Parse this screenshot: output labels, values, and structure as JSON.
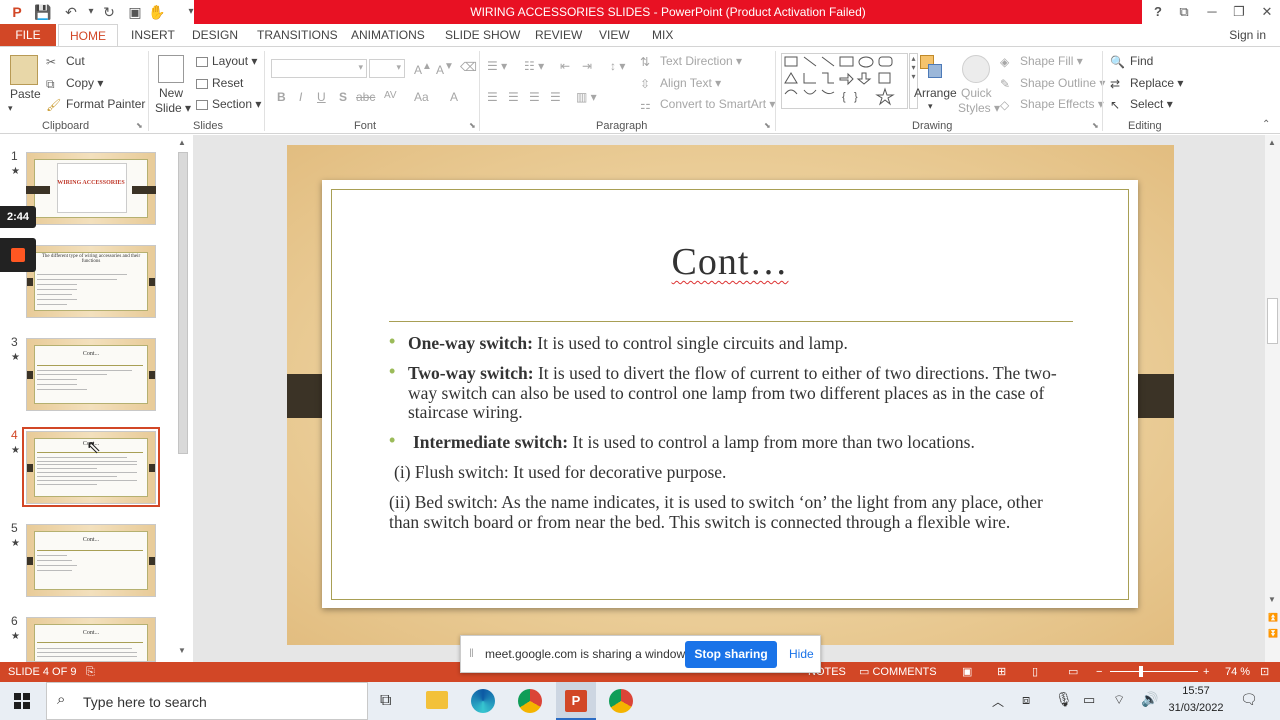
{
  "window": {
    "title": "WIRING ACCESSORIES SLIDES -  PowerPoint (Product Activation Failed)",
    "help": "?",
    "sign_in": "Sign in"
  },
  "tabs": [
    "FILE",
    "HOME",
    "INSERT",
    "DESIGN",
    "TRANSITIONS",
    "ANIMATIONS",
    "SLIDE SHOW",
    "REVIEW",
    "VIEW",
    "MIX"
  ],
  "ribbon": {
    "clipboard": {
      "label": "Clipboard",
      "paste": "Paste",
      "cut": "Cut",
      "copy": "Copy",
      "format_painter": "Format Painter"
    },
    "slides": {
      "label": "Slides",
      "new_slide_1": "New",
      "new_slide_2": "Slide",
      "layout": "Layout",
      "reset": "Reset",
      "section": "Section"
    },
    "font": {
      "label": "Font",
      "bold": "B",
      "italic": "I",
      "underline": "U",
      "shadow": "S",
      "strike": "abc",
      "spacing": "AV",
      "case": "Aa",
      "color": "A"
    },
    "paragraph": {
      "label": "Paragraph",
      "text_direction": "Text Direction",
      "align_text": "Align Text",
      "convert_smartart": "Convert to SmartArt"
    },
    "drawing": {
      "label": "Drawing",
      "arrange": "Arrange",
      "quick_styles_1": "Quick",
      "quick_styles_2": "Styles",
      "shape_fill": "Shape Fill",
      "shape_outline": "Shape Outline",
      "shape_effects": "Shape Effects"
    },
    "editing": {
      "label": "Editing",
      "find": "Find",
      "replace": "Replace",
      "select": "Select"
    }
  },
  "overlay": {
    "timer": "2:44"
  },
  "slides_pane": [
    {
      "num": "1",
      "star": "★",
      "title": "WIRING ACCESSORIES"
    },
    {
      "num": "",
      "star": "★",
      "title": "The different type of wiring accessories and their functions"
    },
    {
      "num": "3",
      "star": "★",
      "title": "Cont..."
    },
    {
      "num": "4",
      "star": "★",
      "title": "Cont..."
    },
    {
      "num": "5",
      "star": "★",
      "title": "Cont..."
    },
    {
      "num": "6",
      "star": "★",
      "title": "Cont..."
    }
  ],
  "slide": {
    "title": "Cont…",
    "items": [
      {
        "bold": "One-way switch:",
        "text": " It is used to control single circuits and lamp."
      },
      {
        "bold": "Two-way switch:",
        "text": " It is used to divert the flow of current to either of two directions. The two-way switch can also be used to control one lamp from two different places as in the case of staircase wiring."
      },
      {
        "bold": "Intermediate switch:",
        "text": " It is used to control a lamp from more than two locations."
      }
    ],
    "sub_items": [
      "(i) Flush switch: It used for decorative purpose.",
      "(ii) Bed switch: As the name indicates, it is used to switch ‘on’ the light from any place, other than switch board or from near the bed. This switch is connected through a flexible wire."
    ]
  },
  "status": {
    "slide_of": "SLIDE 4 OF 9",
    "notes": "NOTES",
    "comments": "COMMENTS",
    "zoom": "74 %"
  },
  "share": {
    "text": "meet.google.com is sharing a window.",
    "stop": "Stop sharing",
    "hide": "Hide"
  },
  "taskbar": {
    "search_placeholder": "Type here to search",
    "time": "15:57",
    "date": "31/03/2022"
  },
  "colors": {
    "accent": "#d24726",
    "title_red": "#e81123",
    "bullet_green": "#9bbb59",
    "share_blue": "#1a73e8"
  }
}
